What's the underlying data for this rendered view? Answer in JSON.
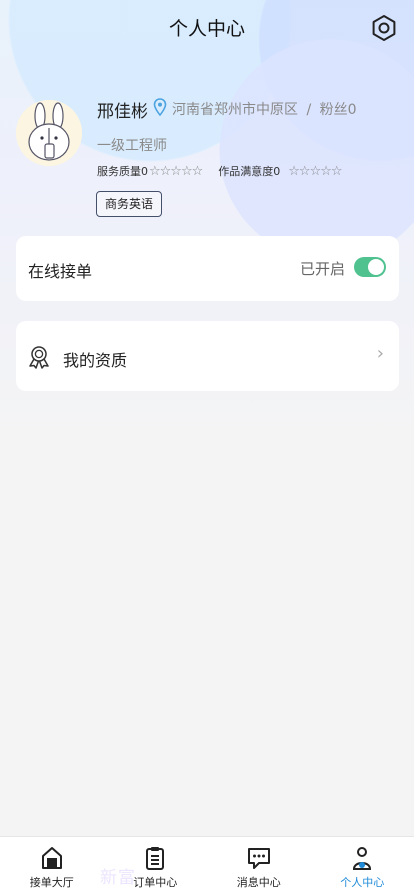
{
  "header": {
    "title": "个人中心",
    "settings_icon": "settings-hexagon-icon"
  },
  "profile": {
    "name": "邢佳彬",
    "location": "河南省郑州市中原区",
    "separator": "/",
    "fans": "粉丝0",
    "grade": "一级工程师",
    "service_quality_label": "服务质量0",
    "service_quality_stars": "☆☆☆☆☆",
    "satisfaction_label": "作品满意度0",
    "satisfaction_stars": "☆☆☆☆☆",
    "service_quality_rating": 0,
    "satisfaction_rating": 0,
    "tag": "商务英语"
  },
  "online": {
    "label": "在线接单",
    "status": "已开启",
    "enabled": true
  },
  "qualification": {
    "label": "我的资质"
  },
  "tabbar": {
    "items": [
      {
        "label": "接单大厅",
        "icon": "home-icon"
      },
      {
        "label": "订单中心",
        "icon": "clipboard-icon"
      },
      {
        "label": "消息中心",
        "icon": "message-icon"
      },
      {
        "label": "个人中心",
        "icon": "user-icon"
      }
    ],
    "active_index": 3
  },
  "watermark": "新富",
  "colors": {
    "accent": "#1e8ad8",
    "toggle_on": "#4fc28f"
  }
}
